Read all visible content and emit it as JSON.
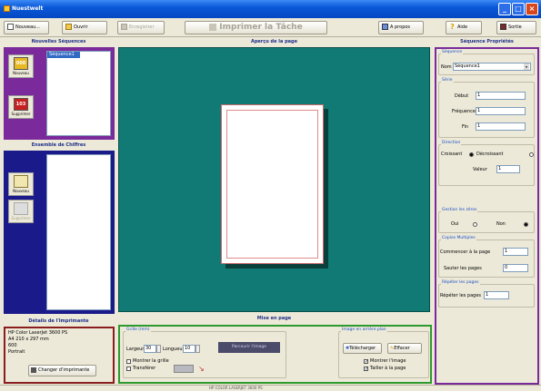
{
  "window": {
    "title": "Nuestwelt"
  },
  "toolbar": {
    "new_label": "Nouveau...",
    "open_label": "Ouvrir",
    "save_label": "Enregistrer",
    "print_task_label": "Imprimer la Tâche",
    "about_label": "A propos",
    "help_label": "Aide",
    "exit_label": "Sortie"
  },
  "sequences": {
    "header": "Nouvelles Séquences",
    "list_items": [
      "Séquence1"
    ],
    "new_button": "Nouveau",
    "delete_button": "Supprimer",
    "new_icon_text": "000",
    "delete_icon_text": "103"
  },
  "numbers": {
    "header": "Ensemble de Chiffres",
    "new_button": "Nouveau",
    "delete_button": "Supprimer"
  },
  "printer": {
    "header": "Détails de l'Imprimante",
    "lines": [
      "HP Color LaserJet 3600 PS",
      "A4 210 x 297 mm",
      "600",
      "Portrait"
    ],
    "change_button": "Changer d'imprimante"
  },
  "preview": {
    "header": "Aperçu de la page"
  },
  "layout": {
    "header": "Mise en page",
    "grid_legend": "Grille (mm)",
    "width_label": "Largeur",
    "width_value": "30",
    "length_label": "Longueur",
    "length_value": "10",
    "show_grid_label": "Montrer la grille",
    "transparent_label": "Transférer",
    "dark_button": "Parcourir l'image",
    "image_legend": "Image en arrière plan",
    "load_label": "Télécharger",
    "clear_label": "Effacer",
    "show_image_label": "Montrer l'image",
    "fit_label": "Tailler à la page"
  },
  "properties": {
    "header": "Séquence Propriétés",
    "seq_legend": "Séquence",
    "name_label": "Nom",
    "name_value": "Séquence1",
    "series_legend": "Série",
    "start_label": "Début",
    "start_value": "1",
    "step_label": "Fréquence",
    "step_value": "1",
    "end_label": "Fin",
    "end_value": "1",
    "direction_legend": "Direction",
    "incr_label": "Croissant",
    "decr_label": "Décroissant",
    "value_label": "Valeur",
    "value_value": "1",
    "zeros_legend": "Gestion les zéros",
    "yes_label": "Oui",
    "no_label": "Non",
    "copies_legend": "Copies Multiples",
    "start_page_label": "Commencer à la page",
    "start_page_value": "1",
    "skip_label": "Sauter les pages",
    "skip_value": "0",
    "repeat_legend": "Répéter les pages",
    "repeat_label": "Répéter les pages",
    "repeat_value": "1"
  },
  "statusbar": {
    "text": "HP COLOR LASERJET 3600 PS"
  },
  "colors": {
    "accent_purple": "#7a2a9a",
    "accent_blue": "#1a1a8a",
    "accent_maroon": "#8a1e1e",
    "accent_green": "#2e9a2e",
    "preview_bg": "#117a74"
  }
}
